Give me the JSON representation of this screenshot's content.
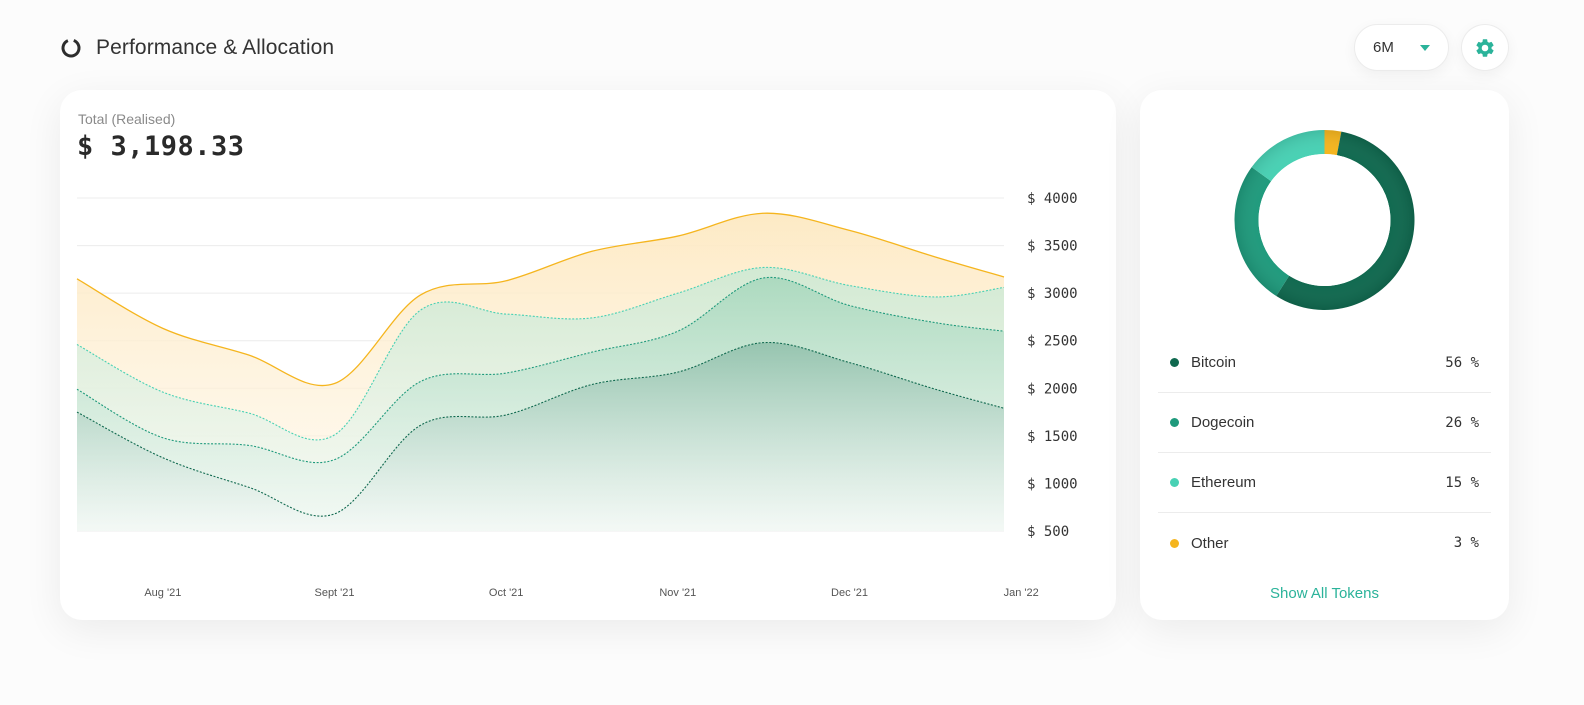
{
  "header": {
    "title": "Performance & Allocation"
  },
  "controls": {
    "range": "6M"
  },
  "summary": {
    "label": "Total (Realised)",
    "value": "$ 3,198.33"
  },
  "colors": {
    "accent": "#2bb39a",
    "other": "#f5b51e",
    "ethereum": "#48d1b4",
    "dogecoin": "#1f9a7c",
    "bitcoin": "#10694f"
  },
  "allocation": {
    "tokens": [
      {
        "name": "Bitcoin",
        "percent": 56,
        "display": "56 %",
        "color": "#10694f"
      },
      {
        "name": "Dogecoin",
        "percent": 26,
        "display": "26 %",
        "color": "#1f9a7c"
      },
      {
        "name": "Ethereum",
        "percent": 15,
        "display": "15 %",
        "color": "#48d1b4"
      },
      {
        "name": "Other",
        "percent": 3,
        "display": "3 %",
        "color": "#f5b51e"
      }
    ],
    "show_all_label": "Show All Tokens"
  },
  "chart_data": {
    "type": "area",
    "x": [
      0,
      0.5,
      1,
      1.5,
      2,
      2.5,
      3,
      3.5,
      4,
      4.5,
      5,
      5.4
    ],
    "categories": [
      "Aug '21",
      "Sept '21",
      "Oct '21",
      "Nov '21",
      "Dec '21",
      "Jan '22"
    ],
    "y_ticks": [
      "$ 4000",
      "$ 3500",
      "$ 3000",
      "$ 2500",
      "$ 2000",
      "$ 1500",
      "$ 1000",
      "$ 500"
    ],
    "ylim": [
      500,
      4000
    ],
    "series": [
      {
        "color": "#f5b51e",
        "values": [
          3150,
          2630,
          2350,
          2050,
          2980,
          3130,
          3440,
          3600,
          3840,
          3660,
          3380,
          3170
        ]
      },
      {
        "color": "#48d1b4",
        "values": [
          2460,
          1960,
          1740,
          1510,
          2820,
          2780,
          2740,
          3000,
          3270,
          3080,
          2960,
          3060
        ]
      },
      {
        "color": "#1f9a7c",
        "values": [
          1990,
          1480,
          1400,
          1250,
          2070,
          2160,
          2380,
          2600,
          3160,
          2870,
          2690,
          2600
        ]
      },
      {
        "color": "#10694f",
        "values": [
          1750,
          1270,
          960,
          680,
          1610,
          1720,
          2040,
          2170,
          2480,
          2270,
          1990,
          1790
        ]
      }
    ],
    "grid": true
  }
}
